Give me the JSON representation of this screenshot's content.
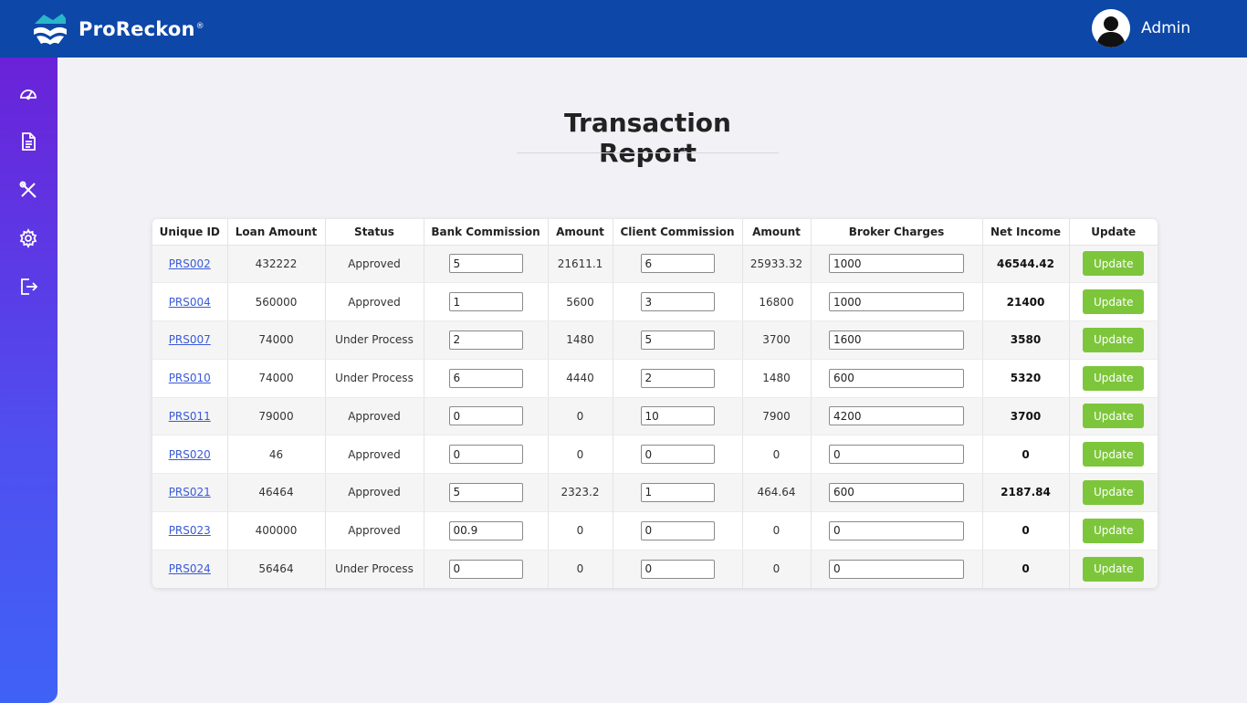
{
  "brand": {
    "name": "ProReckon",
    "mark": "®"
  },
  "user": {
    "name": "Admin"
  },
  "sidebar": {
    "items": [
      {
        "icon": "dashboard-icon"
      },
      {
        "icon": "document-icon"
      },
      {
        "icon": "tools-icon"
      },
      {
        "icon": "gear-icon"
      },
      {
        "icon": "logout-icon"
      }
    ]
  },
  "page": {
    "title": "Transaction Report"
  },
  "colors": {
    "topbar": "#0d47a8",
    "sidebar_top": "#6a22d8",
    "sidebar_bottom": "#3f62f6",
    "update_button": "#7dc63c",
    "link": "#3a5bd6"
  },
  "table": {
    "headers": [
      "Unique ID",
      "Loan Amount",
      "Status",
      "Bank Commission",
      "Amount",
      "Client Commission",
      "Amount",
      "Broker Charges",
      "Net Income",
      "Update"
    ],
    "rows": [
      {
        "id": "PRS002",
        "loan": "432222",
        "status": "Approved",
        "bank": "5",
        "bank_amount": "21611.1",
        "client": "6",
        "client_amount": "25933.32",
        "broker": "1000",
        "net": "46544.42",
        "button": "Update"
      },
      {
        "id": "PRS004",
        "loan": "560000",
        "status": "Approved",
        "bank": "1",
        "bank_amount": "5600",
        "client": "3",
        "client_amount": "16800",
        "broker": "1000",
        "net": "21400",
        "button": "Update"
      },
      {
        "id": "PRS007",
        "loan": "74000",
        "status": "Under Process",
        "bank": "2",
        "bank_amount": "1480",
        "client": "5",
        "client_amount": "3700",
        "broker": "1600",
        "net": "3580",
        "button": "Update"
      },
      {
        "id": "PRS010",
        "loan": "74000",
        "status": "Under Process",
        "bank": "6",
        "bank_amount": "4440",
        "client": "2",
        "client_amount": "1480",
        "broker": "600",
        "net": "5320",
        "button": "Update"
      },
      {
        "id": "PRS011",
        "loan": "79000",
        "status": "Approved",
        "bank": "0",
        "bank_amount": "0",
        "client": "10",
        "client_amount": "7900",
        "broker": "4200",
        "net": "3700",
        "button": "Update"
      },
      {
        "id": "PRS020",
        "loan": "46",
        "status": "Approved",
        "bank": "0",
        "bank_amount": "0",
        "client": "0",
        "client_amount": "0",
        "broker": "0",
        "net": "0",
        "button": "Update"
      },
      {
        "id": "PRS021",
        "loan": "46464",
        "status": "Approved",
        "bank": "5",
        "bank_amount": "2323.2",
        "client": "1",
        "client_amount": "464.64",
        "broker": "600",
        "net": "2187.84",
        "button": "Update"
      },
      {
        "id": "PRS023",
        "loan": "400000",
        "status": "Approved",
        "bank": "00.9",
        "bank_amount": "0",
        "client": "0",
        "client_amount": "0",
        "broker": "0",
        "net": "0",
        "button": "Update"
      },
      {
        "id": "PRS024",
        "loan": "56464",
        "status": "Under Process",
        "bank": "0",
        "bank_amount": "0",
        "client": "0",
        "client_amount": "0",
        "broker": "0",
        "net": "0",
        "button": "Update"
      }
    ]
  }
}
